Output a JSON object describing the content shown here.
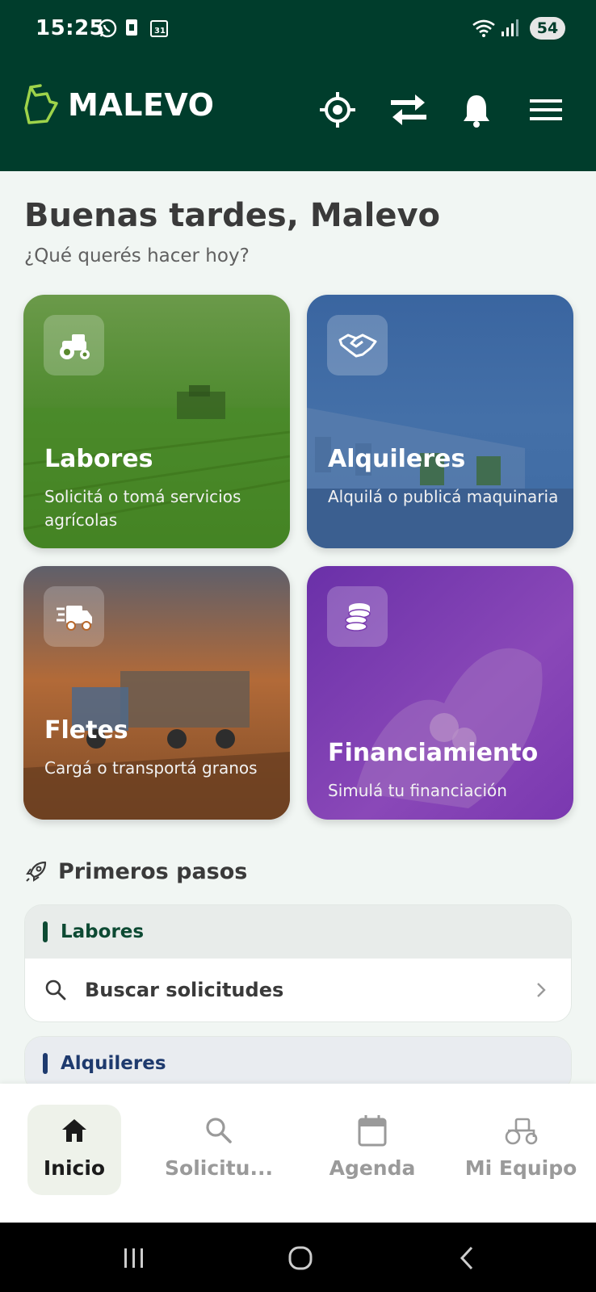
{
  "status": {
    "time": "15:25",
    "battery": "54"
  },
  "header": {
    "brand": "MALEVO"
  },
  "greeting": {
    "title": "Buenas tardes, Malevo",
    "subtitle": "¿Qué querés hacer hoy?"
  },
  "cards": [
    {
      "title": "Labores",
      "desc": "Solicitá o tomá servicios agrícolas",
      "icon": "tractor-gear-icon",
      "color": "#5a8a2e"
    },
    {
      "title": "Alquileres",
      "desc": "Alquilá o publicá maquinaria",
      "icon": "handshake-icon",
      "color": "#3f6aa0"
    },
    {
      "title": "Fletes",
      "desc": "Cargá o transportá granos",
      "icon": "truck-icon",
      "color": "#b8682c"
    },
    {
      "title": "Financiamiento",
      "desc": "Simulá tu financiación",
      "icon": "coins-icon",
      "color": "#7a3bb0"
    }
  ],
  "first_steps": {
    "title": "Primeros pasos",
    "groups": [
      {
        "label": "Labores",
        "accent": "#0d4a33",
        "items": [
          {
            "label": "Buscar solicitudes"
          }
        ]
      },
      {
        "label": "Alquileres",
        "accent": "#1e3a6e",
        "items": []
      }
    ]
  },
  "bottom_nav": [
    {
      "label": "Inicio",
      "icon": "home-icon",
      "active": true
    },
    {
      "label": "Solicitu...",
      "icon": "search-icon",
      "active": false
    },
    {
      "label": "Agenda",
      "icon": "calendar-icon",
      "active": false
    },
    {
      "label": "Mi Equipo",
      "icon": "tractor-icon",
      "active": false
    }
  ]
}
